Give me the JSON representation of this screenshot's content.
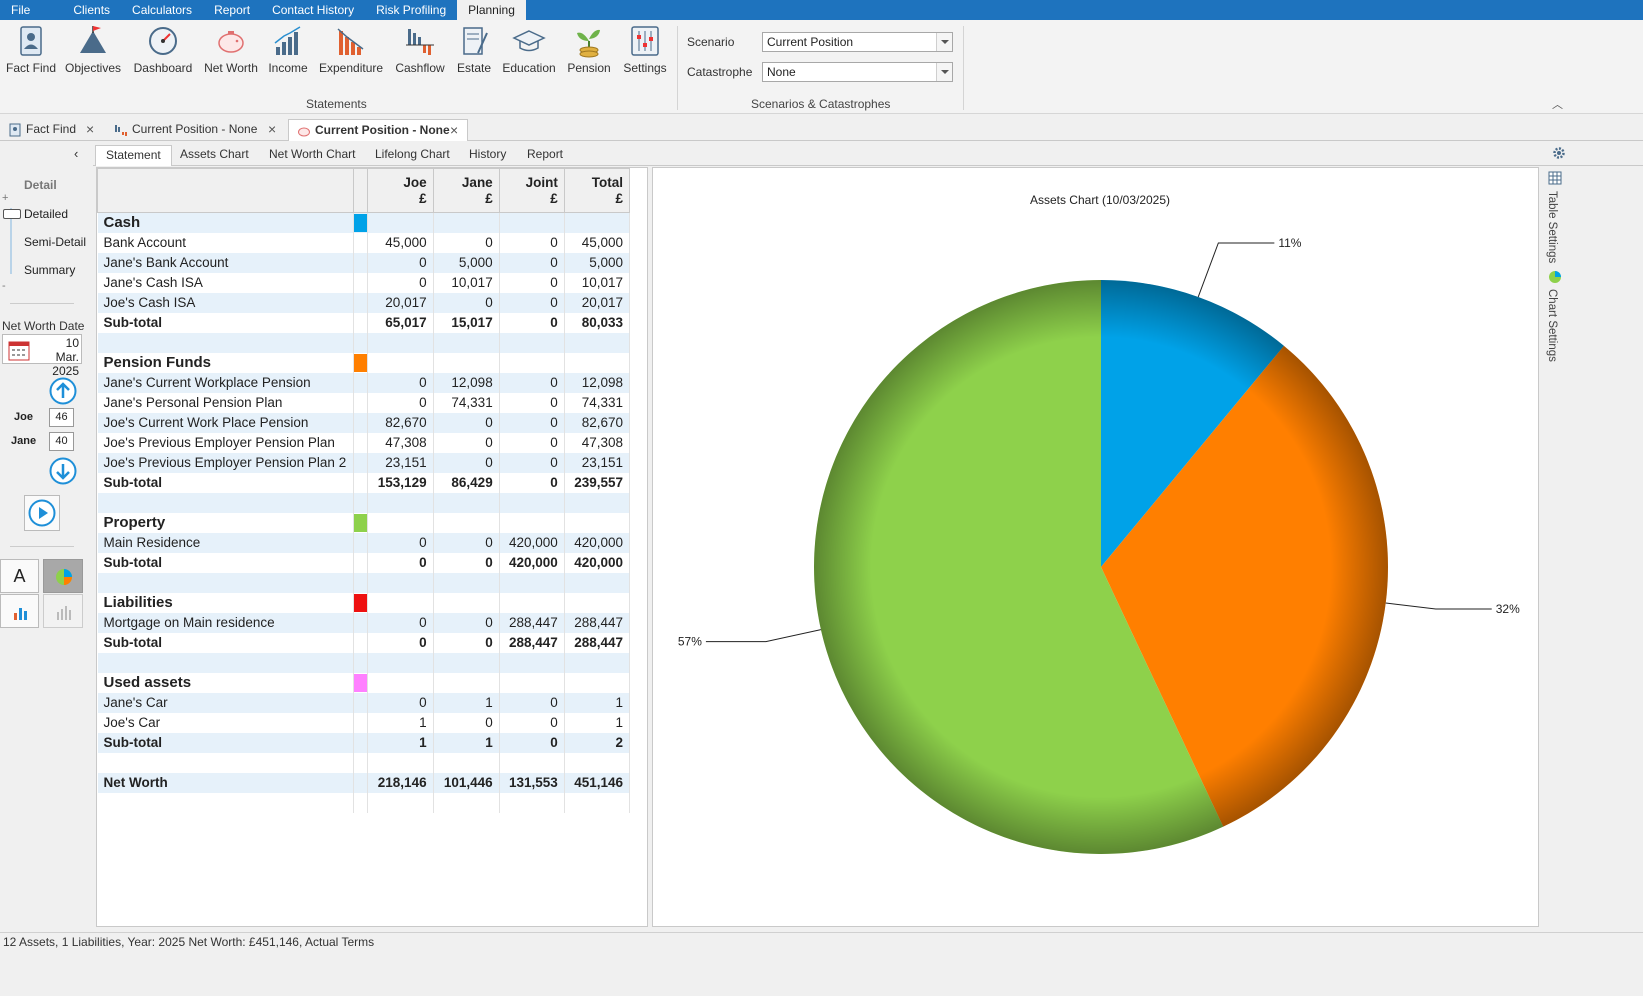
{
  "menu": [
    "File",
    "Clients",
    "Calculators",
    "Report",
    "Contact History",
    "Risk Profiling",
    "Planning"
  ],
  "ribbon": {
    "buttons": [
      "Fact Find",
      "Objectives",
      "Dashboard",
      "Net Worth",
      "Income",
      "Expenditure",
      "Cashflow",
      "Estate",
      "Education",
      "Pension",
      "Settings"
    ],
    "statements_label": "Statements",
    "scenario_label": "Scenario",
    "scenario_value": "Current Position",
    "catastrophe_label": "Catastrophe",
    "catastrophe_value": "None",
    "scenarios_group_label": "Scenarios & Catastrophes"
  },
  "doc_tabs": [
    "Fact Find",
    "Current Position - None",
    "Current Position - None"
  ],
  "sub_tabs": [
    "Statement",
    "Assets Chart",
    "Net Worth Chart",
    "Lifelong Chart",
    "History",
    "Report"
  ],
  "left": {
    "detail_title": "Detail",
    "levels": [
      "Detailed",
      "Semi-Detail",
      "Summary"
    ],
    "net_worth_date_label": "Net Worth Date",
    "date_day_month": "10 Mar.",
    "date_year": "2025",
    "people": [
      {
        "name": "Joe",
        "age": "46"
      },
      {
        "name": "Jane",
        "age": "40"
      }
    ],
    "text_btn": "A"
  },
  "table": {
    "headers": [
      {
        "name": "Joe",
        "unit": "£"
      },
      {
        "name": "Jane",
        "unit": "£"
      },
      {
        "name": "Joint",
        "unit": "£"
      },
      {
        "name": "Total",
        "unit": "£"
      }
    ],
    "sections": [
      {
        "title": "Cash",
        "color": "#00a2e8",
        "rows": [
          [
            "Bank Account",
            "45,000",
            "0",
            "0",
            "45,000"
          ],
          [
            "Jane's Bank Account",
            "0",
            "5,000",
            "0",
            "5,000"
          ],
          [
            "Jane's Cash ISA",
            "0",
            "10,017",
            "0",
            "10,017"
          ],
          [
            "Joe's Cash ISA",
            "20,017",
            "0",
            "0",
            "20,017"
          ]
        ],
        "subtotal": [
          "Sub-total",
          "65,017",
          "15,017",
          "0",
          "80,033"
        ]
      },
      {
        "title": "Pension Funds",
        "color": "#ff7f00",
        "rows": [
          [
            "Jane's Current Workplace Pension",
            "0",
            "12,098",
            "0",
            "12,098"
          ],
          [
            "Jane's Personal Pension Plan",
            "0",
            "74,331",
            "0",
            "74,331"
          ],
          [
            "Joe's Current Work Place Pension",
            "82,670",
            "0",
            "0",
            "82,670"
          ],
          [
            "Joe's Previous Employer Pension Plan",
            "47,308",
            "0",
            "0",
            "47,308"
          ],
          [
            "Joe's Previous Employer Pension Plan 2",
            "23,151",
            "0",
            "0",
            "23,151"
          ]
        ],
        "subtotal": [
          "Sub-total",
          "153,129",
          "86,429",
          "0",
          "239,557"
        ]
      },
      {
        "title": "Property",
        "color": "#8ed14b",
        "rows": [
          [
            "Main Residence",
            "0",
            "0",
            "420,000",
            "420,000"
          ]
        ],
        "subtotal": [
          "Sub-total",
          "0",
          "0",
          "420,000",
          "420,000"
        ]
      },
      {
        "title": "Liabilities",
        "color": "#ee1111",
        "rows": [
          [
            "Mortgage on Main residence",
            "0",
            "0",
            "288,447",
            "288,447"
          ]
        ],
        "subtotal": [
          "Sub-total",
          "0",
          "0",
          "288,447",
          "288,447"
        ]
      },
      {
        "title": "Used assets",
        "color": "#ff80ff",
        "rows": [
          [
            "Jane's Car",
            "0",
            "1",
            "0",
            "1"
          ],
          [
            "Joe's Car",
            "1",
            "0",
            "0",
            "1"
          ]
        ],
        "subtotal": [
          "Sub-total",
          "1",
          "1",
          "0",
          "2"
        ]
      }
    ],
    "net_worth": [
      "Net Worth",
      "218,146",
      "101,446",
      "131,553",
      "451,146"
    ]
  },
  "chart_data": {
    "type": "pie",
    "title": "Assets Chart (10/03/2025)",
    "labels": [
      "Cash",
      "Pension Funds",
      "Property"
    ],
    "values": [
      11,
      32,
      57
    ],
    "value_labels": [
      "11%",
      "32%",
      "57%"
    ],
    "colors": [
      "#00a2e8",
      "#ff7f00",
      "#8ed14b"
    ],
    "legend": "none"
  },
  "right_strip": {
    "table_settings": "Table Settings",
    "chart_settings": "Chart Settings"
  },
  "status": "12 Assets, 1 Liabilities, Year: 2025 Net Worth: £451,146, Actual Terms"
}
